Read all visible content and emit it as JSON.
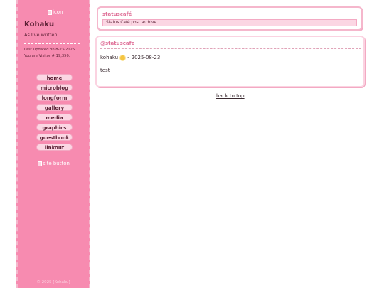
{
  "sidebar": {
    "icon_alt": "icon",
    "title": "Kohaku",
    "tagline": "As I've written.",
    "last_updated": "Last Updated on 8-23-2025.",
    "visitor": "You are Visitor # 19,350.",
    "nav": [
      {
        "label": "home"
      },
      {
        "label": "microblog"
      },
      {
        "label": "longform"
      },
      {
        "label": "gallery"
      },
      {
        "label": "media"
      },
      {
        "label": "graphics"
      },
      {
        "label": "guestbook"
      },
      {
        "label": "linkout"
      }
    ],
    "site_button_alt": "site button",
    "footer": "© 2025 [Kohaku]"
  },
  "main": {
    "header_card": {
      "title": "statuscafé",
      "description": "Status Café post archive."
    },
    "post_card": {
      "handle": "@statuscafe",
      "author": "kohaku",
      "date": "2025-08-23",
      "separator": "-",
      "body": "test"
    },
    "back_to_top": "back to top"
  },
  "colors": {
    "sidebar_bg": "#f78bb0",
    "accent": "#e0739a",
    "nav_btn_bg": "#fbd6e3"
  }
}
